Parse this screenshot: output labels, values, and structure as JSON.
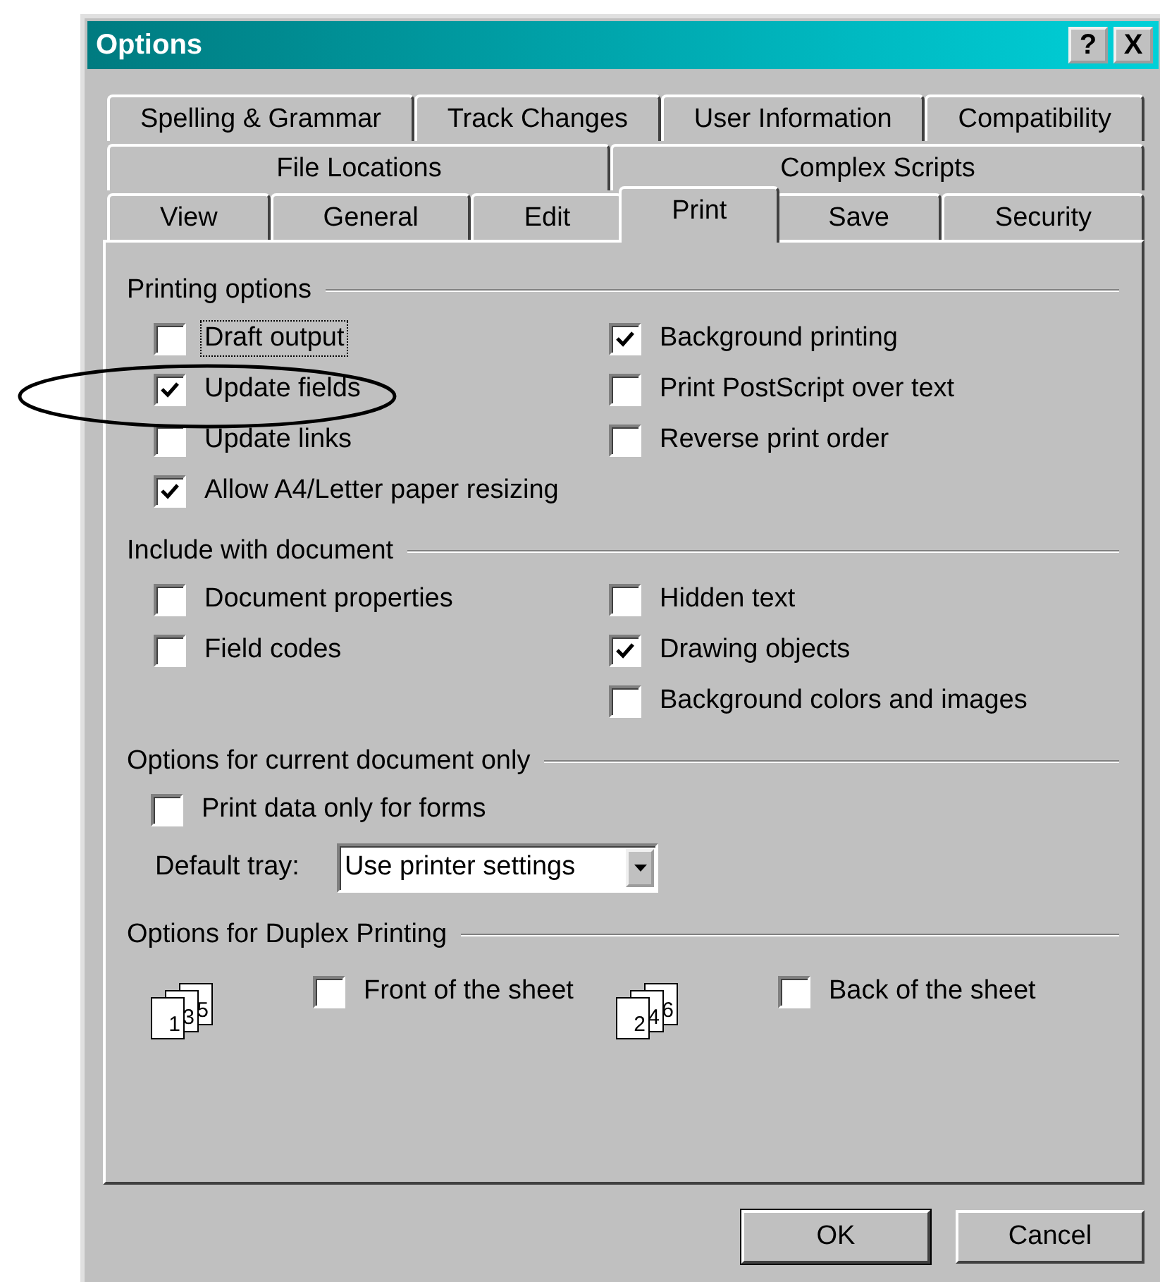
{
  "window": {
    "title": "Options",
    "buttons": [
      "?",
      "X"
    ]
  },
  "tab_rows": [
    [
      {
        "label": "Spelling & Grammar",
        "selected": false
      },
      {
        "label": "Track Changes",
        "selected": false
      },
      {
        "label": "User Information",
        "selected": false
      },
      {
        "label": "Compatibility",
        "selected": false
      }
    ],
    [
      {
        "label": "File Locations",
        "selected": false
      },
      {
        "label": "Complex Scripts",
        "selected": false
      }
    ],
    [
      {
        "label": "View",
        "selected": false
      },
      {
        "label": "General",
        "selected": false
      },
      {
        "label": "Edit",
        "selected": false
      },
      {
        "label": "Print",
        "selected": true
      },
      {
        "label": "Save",
        "selected": false
      },
      {
        "label": "Security",
        "selected": false
      }
    ]
  ],
  "sections": [
    {
      "kind": "columns",
      "title": "Printing options",
      "left": [
        {
          "label": "Draft output",
          "checked": false,
          "focused": true
        },
        {
          "label": "Update fields",
          "checked": true,
          "focused": false
        },
        {
          "label": "Update links",
          "checked": false,
          "focused": false
        },
        {
          "label": "Allow A4/Letter paper resizing",
          "checked": true,
          "focused": false
        }
      ],
      "right": [
        {
          "label": "Background printing",
          "checked": true,
          "focused": false
        },
        {
          "label": "Print PostScript over text",
          "checked": false,
          "focused": false
        },
        {
          "label": "Reverse print order",
          "checked": false,
          "focused": false
        }
      ]
    },
    {
      "kind": "columns",
      "title": "Include with document",
      "left": [
        {
          "label": "Document properties",
          "checked": false
        },
        {
          "label": "Field codes",
          "checked": false
        }
      ],
      "right": [
        {
          "label": "Hidden text",
          "checked": false
        },
        {
          "label": "Drawing objects",
          "checked": true
        },
        {
          "label": "Background colors and images",
          "checked": false
        }
      ]
    },
    {
      "kind": "list",
      "title": "Options for current document only",
      "items": [
        {
          "kind": "checkbox",
          "label": "Print data only for forms",
          "checked": false
        },
        {
          "kind": "dropdown",
          "label": "Default tray:",
          "value": "Use printer settings"
        }
      ]
    },
    {
      "kind": "duplex",
      "title": "Options for Duplex Printing",
      "items": [
        {
          "pages": [
            "1",
            "3",
            "5"
          ],
          "label": "Front of the sheet",
          "checked": false
        },
        {
          "pages": [
            "2",
            "4",
            "6"
          ],
          "label": "Back of the sheet",
          "checked": false
        }
      ]
    }
  ],
  "buttons": [
    {
      "label": "OK",
      "default": true
    },
    {
      "label": "Cancel",
      "default": false
    }
  ]
}
